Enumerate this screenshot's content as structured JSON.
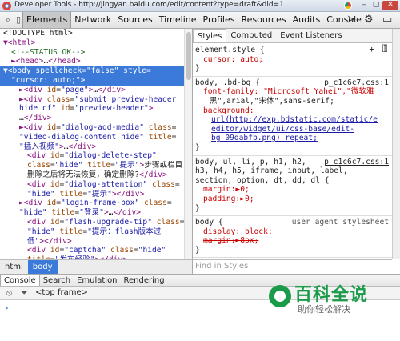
{
  "window": {
    "title": "Developer Tools - http://jingyan.baidu.com/edit/content?type=draft&did=1",
    "min": "–",
    "max": "▢",
    "close": "✕"
  },
  "toolbar": {
    "tabs": [
      "Elements",
      "Network",
      "Sources",
      "Timeline",
      "Profiles",
      "Resources",
      "Audits",
      "Console"
    ],
    "active_tab": "Elements",
    "search_icon": "magnifier",
    "device_icon": "mobile-device"
  },
  "elements": {
    "lines": [
      {
        "i": 0,
        "html": "<span class='tx'>&lt;!DOCTYPE html&gt;</span>"
      },
      {
        "i": 0,
        "html": "<span class='tag'>▼&lt;html&gt;</span>"
      },
      {
        "i": 1,
        "html": "<span class='cm'>&lt;!--STATUS OK--&gt;</span>"
      },
      {
        "i": 1,
        "html": "<span class='tag'>►&lt;head&gt;</span>…<span class='tag'>&lt;/head&gt;</span>"
      }
    ],
    "selected_line1": "▼<body spellcheck=\"false\" style=",
    "selected_line2": "\"cursor: auto;\">",
    "lines2": [
      {
        "i": 2,
        "html": "<span class='tag'>►&lt;div </span><span class='an'>id</span>=<span class='av'>\"page\"</span><span class='tag'>&gt;</span>…<span class='tag'>&lt;/div&gt;</span>"
      },
      {
        "i": 2,
        "html": "<span class='tag'>►&lt;div </span><span class='an'>class</span>=<span class='av'>\"submit preview-header</span>"
      },
      {
        "i": 2,
        "html": "<span class='av'>hide cf\"</span> <span class='an'>id</span>=<span class='av'>\"preview-header\"</span><span class='tag'>&gt;</span>"
      },
      {
        "i": 2,
        "html": "…<span class='tag'>&lt;/div&gt;</span>"
      },
      {
        "i": 2,
        "html": "<span class='tag'>►&lt;div </span><span class='an'>id</span>=<span class='av'>\"dialog-add-media\"</span> <span class='an'>class</span>="
      },
      {
        "i": 2,
        "html": "<span class='av'>\"video-dialog-content hide\"</span> <span class='an'>title</span>="
      },
      {
        "i": 2,
        "html": "<span class='av'>\"插入视频\"</span><span class='tag'>&gt;</span>…<span class='tag'>&lt;/div&gt;</span>"
      },
      {
        "i": 3,
        "html": "<span class='tag'>&lt;div </span><span class='an'>id</span>=<span class='av'>\"dialog-delete-step\"</span>"
      },
      {
        "i": 3,
        "html": "<span class='an'>class</span>=<span class='av'>\"hide\"</span> <span class='an'>title</span>=<span class='av'>\"提示\"</span><span class='tag'>&gt;</span>步骤或栏目"
      },
      {
        "i": 3,
        "html": "删除之后将无法恢复，确定删除?<span class='tag'>&lt;/div&gt;</span>"
      },
      {
        "i": 3,
        "html": "<span class='tag'>&lt;div </span><span class='an'>id</span>=<span class='av'>\"dialog-attention\"</span> <span class='an'>class</span>="
      },
      {
        "i": 3,
        "html": "<span class='av'>\"hide\"</span> <span class='an'>title</span>=<span class='av'>\"提示\"</span><span class='tag'>&gt;&lt;/div&gt;</span>"
      },
      {
        "i": 2,
        "html": "<span class='tag'>►&lt;div </span><span class='an'>id</span>=<span class='av'>\"login-frame-box\"</span> <span class='an'>class</span>="
      },
      {
        "i": 2,
        "html": "<span class='av'>\"hide\"</span> <span class='an'>title</span>=<span class='av'>\"登录\"</span><span class='tag'>&gt;</span>…<span class='tag'>&lt;/div&gt;</span>"
      },
      {
        "i": 3,
        "html": "<span class='tag'>&lt;div </span><span class='an'>id</span>=<span class='av'>\"flash-upgrade-tip\"</span> <span class='an'>class</span>="
      },
      {
        "i": 3,
        "html": "<span class='av'>\"hide\"</span> <span class='an'>title</span>=<span class='av'>\"提示：flash版本过</span>"
      },
      {
        "i": 3,
        "html": "<span class='av'>低\"</span><span class='tag'>&gt;&lt;/div&gt;</span>"
      },
      {
        "i": 3,
        "html": "<span class='tag'>&lt;div </span><span class='an'>id</span>=<span class='av'>\"captcha\"</span> <span class='an'>class</span>=<span class='av'>\"hide\"</span>"
      },
      {
        "i": 3,
        "html": "<span class='an'>title</span>=<span class='av'>\"发布经验\"</span><span class='tag'>&gt;&lt;/div&gt;</span>"
      }
    ]
  },
  "side_tabs": [
    "Styles",
    "Computed",
    "Event Listeners"
  ],
  "side_active": "Styles",
  "styles": {
    "rule1_selector": "element.style {",
    "rule1_decl": "cursor: auto;",
    "rule2_selector": "body, .bd-bg {",
    "rule2_src": "p_c1c6c7.css:1",
    "rule2_decl1": "font-family: \"Microsoft Yahei\",\"微软雅",
    "rule2_decl1b": "黑\",arial,\"宋体\",sans-serif;",
    "rule2_decl2": "background:",
    "rule2_url1": "url(http://exp.bdstatic.com/static/e",
    "rule2_url2": "editor/widget/ui/css-base/edit-",
    "rule2_url3": "bg_09dabfb.png) repeat;",
    "rule3_selector1": "body, ul, li, p, h1, h2,",
    "rule3_src": "p_c1c6c7.css:1",
    "rule3_selector2": "h3, h4, h5, iframe, input, label,",
    "rule3_selector3": "section, option, dt, dd, dl {",
    "rule3_decl1": "margin:►0;",
    "rule3_decl2": "padding:►0;",
    "rule4_selector": "body {",
    "rule4_src": "user agent stylesheet",
    "rule4_decl1": "display: block;",
    "rule4_decl2": "margin:►8px;"
  },
  "breadcrumb": [
    "html",
    "body"
  ],
  "breadcrumb_active": "body",
  "find_placeholder": "Find in Styles",
  "drawer": {
    "tabs": [
      "Console",
      "Search",
      "Emulation",
      "Rendering"
    ],
    "active": "Console",
    "frame": "<top frame>",
    "prompt": "›"
  },
  "watermark": {
    "main": "百科全说",
    "sub": "助你轻松解决"
  }
}
